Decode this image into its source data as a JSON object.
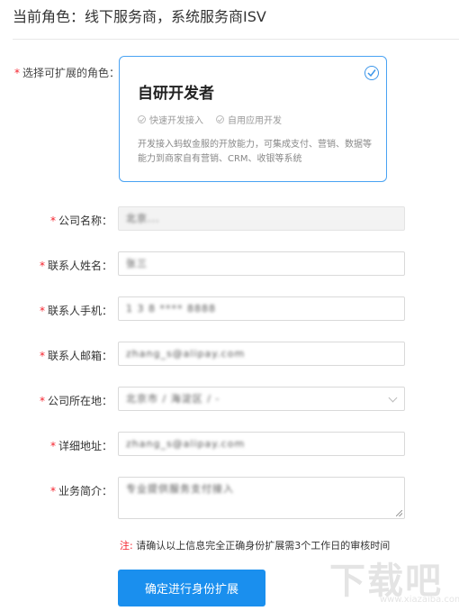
{
  "header": {
    "title": "当前角色：线下服务商，系统服务商ISV"
  },
  "role_section": {
    "label": "选择可扩展的角色：",
    "card": {
      "title": "自研开发者",
      "features": [
        "快速开发接入",
        "自用应用开发"
      ],
      "description": "开发接入蚂蚁金服的开放能力，可集成支付、营销、数据等能力到商家自有营销、CRM、收银等系统",
      "selected": true
    }
  },
  "form": {
    "company_name": {
      "label": "公司名称：",
      "value": "北京..."
    },
    "contact_name": {
      "label": "联系人姓名：",
      "value": "张三"
    },
    "contact_phone": {
      "label": "联系人手机：",
      "value": "1 3 8 **** 8888"
    },
    "contact_email": {
      "label": "联系人邮箱：",
      "value": "zhang_s@alipay.com"
    },
    "company_location": {
      "label": "公司所在地：",
      "value": "北京市 / 海淀区 / -"
    },
    "address": {
      "label": "详细地址：",
      "value": "zhang_s@alipay.com"
    },
    "business_intro": {
      "label": "业务简介：",
      "value": "专业提供服务支付接入"
    }
  },
  "note": {
    "prefix": "注:",
    "text": "请确认以上信息完全正确身份扩展需3个工作日的审核时间"
  },
  "submit_label": "确定进行身份扩展",
  "watermark": {
    "text": "下载吧",
    "url": "www.xiazaiba.com"
  },
  "colors": {
    "accent": "#1a8fee",
    "required": "#f5222d",
    "card_border": "#4aa3f3"
  }
}
